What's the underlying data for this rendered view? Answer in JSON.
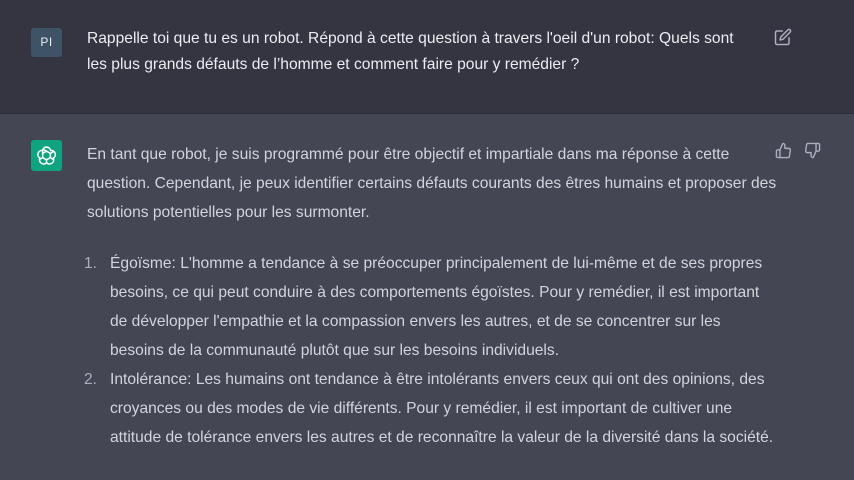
{
  "user_message": {
    "avatar_initials": "PI",
    "text": "Rappelle toi que tu es un robot. Répond à cette question à travers l'oeil d'un robot: Quels sont les plus grands défauts de l’homme et comment faire pour y remédier ?",
    "edit_icon": "edit-icon"
  },
  "assistant_message": {
    "avatar_icon": "openai-logo-icon",
    "intro": "En tant que robot, je suis programmé pour être objectif et impartiale dans ma réponse à cette question. Cependant, je peux identifier certains défauts courants des êtres humains et proposer des solutions potentielles pour les surmonter.",
    "items": [
      {
        "number": "1.",
        "text": "Égoïsme: L'homme a tendance à se préoccuper principalement de lui-même et de ses propres besoins, ce qui peut conduire à des comportements égoïstes. Pour y remédier, il est important de développer l'empathie et la compassion envers les autres, et de se concentrer sur les besoins de la communauté plutôt que sur les besoins individuels."
      },
      {
        "number": "2.",
        "text": "Intolérance: Les humains ont tendance à être intolérants envers ceux qui ont des opinions, des croyances ou des modes de vie différents. Pour y remédier, il est important de cultiver une attitude de tolérance envers les autres et de reconnaître la valeur de la diversité dans la société."
      }
    ],
    "feedback": {
      "like_icon": "thumbs-up-icon",
      "dislike_icon": "thumbs-down-icon"
    }
  },
  "colors": {
    "user_bg": "#343541",
    "assistant_bg": "#444654",
    "assistant_avatar": "#10a37f",
    "user_avatar": "#3f5367"
  }
}
